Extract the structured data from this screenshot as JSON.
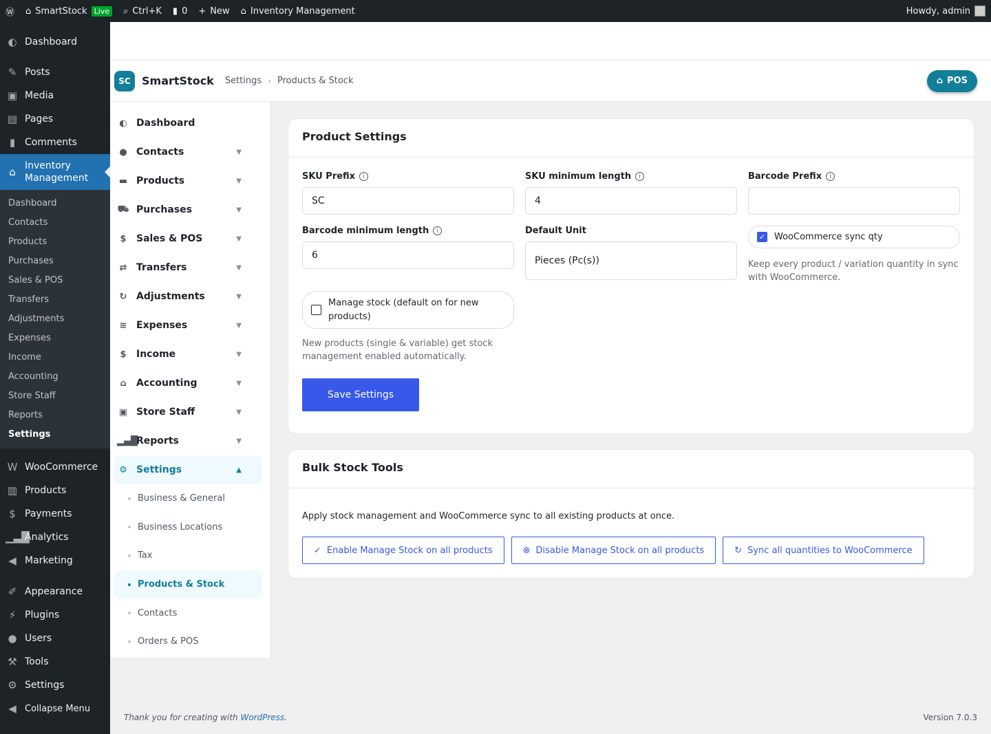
{
  "adminbar": {
    "site": "SmartStock",
    "live": "Live",
    "search": "Ctrl+K",
    "comments": "0",
    "new": "New",
    "plugin": "Inventory Management",
    "howdy": "Howdy, admin"
  },
  "wpmenu": {
    "top": [
      {
        "label": "Dashboard",
        "icon": "dashboard-icon"
      },
      {
        "label": "Posts",
        "icon": "pin-icon"
      },
      {
        "label": "Media",
        "icon": "media-icon"
      },
      {
        "label": "Pages",
        "icon": "pages-icon"
      },
      {
        "label": "Comments",
        "icon": "comments-icon"
      }
    ],
    "current": "Inventory Management",
    "sub": [
      "Dashboard",
      "Contacts",
      "Products",
      "Purchases",
      "Sales & POS",
      "Transfers",
      "Adjustments",
      "Expenses",
      "Income",
      "Accounting",
      "Store Staff",
      "Reports",
      "Settings"
    ],
    "bottom": [
      "WooCommerce",
      "Products",
      "Payments",
      "Analytics",
      "Marketing",
      "Appearance",
      "Plugins",
      "Users",
      "Tools",
      "Settings",
      "Collapse Menu"
    ]
  },
  "app": {
    "logo": "SC",
    "brand": "SmartStock",
    "crumb1": "Settings",
    "crumb2": "Products & Stock",
    "pos": "POS"
  },
  "appnav": [
    "Dashboard",
    "Contacts",
    "Products",
    "Purchases",
    "Sales & POS",
    "Transfers",
    "Adjustments",
    "Expenses",
    "Income",
    "Accounting",
    "Store Staff",
    "Reports",
    "Settings"
  ],
  "settings_sub": [
    "Business & General",
    "Business Locations",
    "Tax",
    "Products & Stock",
    "Contacts",
    "Orders & POS"
  ],
  "product_settings": {
    "title": "Product Settings",
    "sku_prefix_label": "SKU Prefix",
    "sku_prefix": "SC",
    "sku_min_label": "SKU minimum length",
    "sku_min": "4",
    "barcode_prefix_label": "Barcode Prefix",
    "barcode_prefix": "",
    "barcode_min_label": "Barcode minimum length",
    "barcode_min": "6",
    "default_unit_label": "Default Unit",
    "default_unit": "Pieces (Pc(s))",
    "woo_sync_label": "WooCommerce sync qty",
    "woo_sync_checked": true,
    "woo_sync_help": "Keep every product / variation quantity in sync with WooCommerce.",
    "manage_stock_label": "Manage stock (default on for new products)",
    "manage_stock_checked": false,
    "manage_stock_help": "New products (single & variable) get stock management enabled automatically.",
    "save": "Save Settings"
  },
  "bulk": {
    "title": "Bulk Stock Tools",
    "desc": "Apply stock management and WooCommerce sync to all existing products at once.",
    "enable": "Enable Manage Stock on all products",
    "disable": "Disable Manage Stock on all products",
    "sync": "Sync all quantities to WooCommerce"
  },
  "footer": {
    "text": "Thank you for creating with ",
    "link": "WordPress",
    "end": ".",
    "version": "Version 7.0.3"
  }
}
